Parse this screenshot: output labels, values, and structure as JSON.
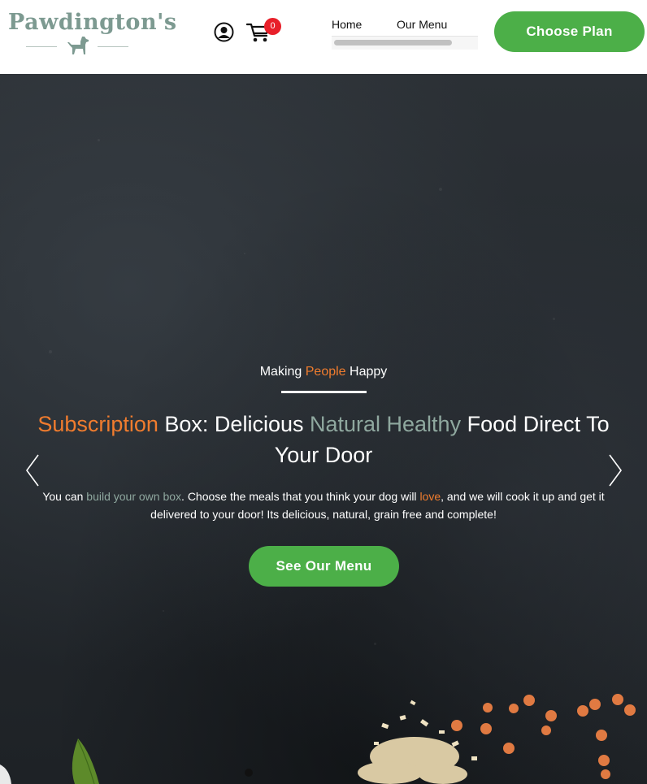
{
  "header": {
    "logo_text": "Pawdington's",
    "user_icon": "user-circle-icon",
    "cart_icon": "shopping-cart-icon",
    "cart_count": "0",
    "nav": {
      "home": "Home",
      "menu": "Our Menu"
    },
    "choose_plan": "Choose Plan"
  },
  "hero": {
    "tagline": {
      "pre": "Making ",
      "accent": "People",
      "post": " Happy"
    },
    "headline": {
      "part1": "Subscription",
      "part2": " Box: Delicious ",
      "part3": "Natural Healthy",
      "part4": " Food Direct To Your Door"
    },
    "description": {
      "part1": "You can ",
      "part2": "build your own box",
      "part3": ". Choose the meals that you think your dog will ",
      "part4": "love",
      "part5": ", and we will cook it up and get it delivered to your door! Its delicious, natural, grain free and complete!"
    },
    "cta": "See Our Menu",
    "prev_icon": "chevron-left-icon",
    "next_icon": "chevron-right-icon"
  },
  "colors": {
    "brand_green": "#4caf48",
    "accent_orange": "#f07c2e",
    "sage": "#8fa89f",
    "badge_red": "#e8202a"
  }
}
